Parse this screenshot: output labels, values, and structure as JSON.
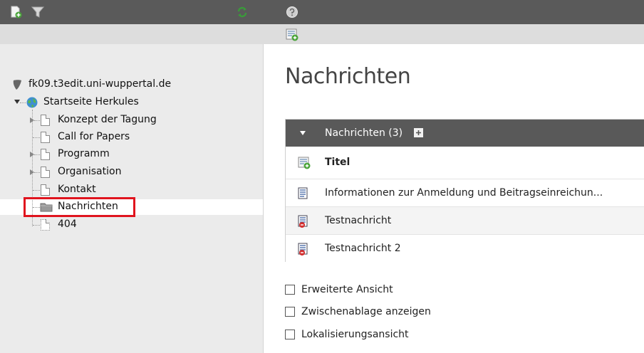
{
  "toolbar": {
    "new_page_icon": "new-page-icon",
    "filter_icon": "filter-icon",
    "refresh_icon": "refresh-icon",
    "help_icon": "help-icon",
    "new_record_icon": "new-record-icon"
  },
  "tree": {
    "root": "fk09.t3edit.uni-wuppertal.de",
    "home": "Startseite Herkules",
    "items": [
      {
        "label": "Konzept der Tagung",
        "expandable": true
      },
      {
        "label": "Call for Papers",
        "expandable": false
      },
      {
        "label": "Programm",
        "expandable": true
      },
      {
        "label": "Organisation",
        "expandable": true
      },
      {
        "label": "Kontakt",
        "expandable": false
      },
      {
        "label": "Nachrichten",
        "expandable": false,
        "selected": true
      },
      {
        "label": "404",
        "expandable": false
      }
    ]
  },
  "main": {
    "title": "Nachrichten",
    "panel": {
      "header": "Nachrichten (3)",
      "column_title": "Titel",
      "records": [
        {
          "label": "Informationen zur Anmeldung und Beitragseinreichun...",
          "status": "visible"
        },
        {
          "label": "Testnachricht",
          "status": "hidden"
        },
        {
          "label": "Testnachricht 2",
          "status": "hidden"
        }
      ]
    },
    "options": [
      {
        "label": "Erweiterte Ansicht",
        "checked": false
      },
      {
        "label": "Zwischenablage anzeigen",
        "checked": false
      },
      {
        "label": "Lokalisierungsansicht",
        "checked": false
      }
    ]
  },
  "colors": {
    "accent_red": "#e0141e",
    "header_dark": "#595959",
    "refresh_green": "#3a9a3a"
  }
}
